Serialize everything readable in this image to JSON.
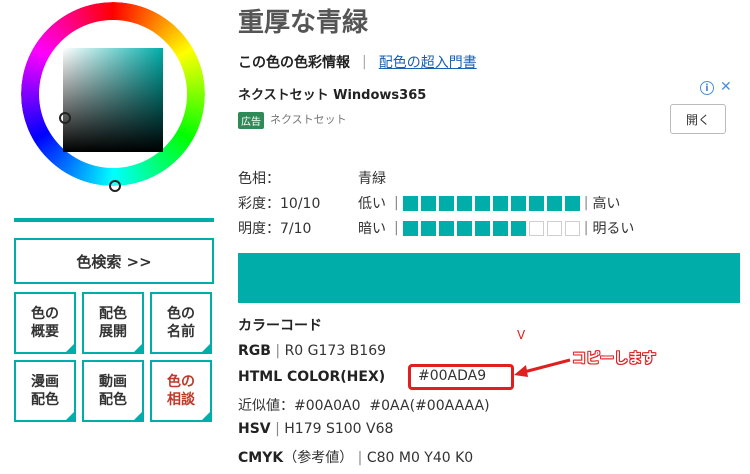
{
  "color_name": "重厚な青緑",
  "info_bar": {
    "label": "この色の色彩情報",
    "separator": "|",
    "link": "配色の超入門書"
  },
  "ad": {
    "title": "ネクストセット Windows365",
    "badge": "広告",
    "source": "ネクストセット",
    "open_label": "開く",
    "info_symbol": "i",
    "close_symbol": "✕"
  },
  "hue": {
    "label": "色相：",
    "value": "青緑"
  },
  "saturation": {
    "label": "彩度：10/10",
    "low": "低い",
    "high": "高い",
    "level": 10,
    "max": 10
  },
  "brightness": {
    "label": "明度：7/10",
    "low": "暗い",
    "high": "明るい",
    "level": 7,
    "max": 10
  },
  "swatch_color": "#00ADA9",
  "sidebar": {
    "search_label": "色検索 >>",
    "tiles": [
      {
        "label": "色の\n概要",
        "name": "tile-color-overview"
      },
      {
        "label": "配色\n展開",
        "name": "tile-color-scheme"
      },
      {
        "label": "色の\n名前",
        "name": "tile-color-name"
      },
      {
        "label": "漫画\n配色",
        "name": "tile-manga-colors"
      },
      {
        "label": "動画\n配色",
        "name": "tile-video-colors"
      },
      {
        "label": "色の\n相談",
        "name": "tile-color-consult"
      }
    ]
  },
  "codes": {
    "heading": "カラーコード",
    "rgb_label": "RGB",
    "rgb_value": "R0 G173 B169",
    "html_label": "HTML COLOR(HEX)",
    "html_value": "#00ADA9",
    "approx_label": "近似値：",
    "approx_value": "#00A0A0  #0AA(#00AAAA)",
    "hsv_label": "HSV",
    "hsv_value": "H179 S100 V68",
    "cmyk_label": "CMYK",
    "cmyk_note": "（参考値）",
    "cmyk_value": "C80 M0 Y40 K0"
  },
  "annotation": {
    "text": "コピーします",
    "mark": "V"
  }
}
